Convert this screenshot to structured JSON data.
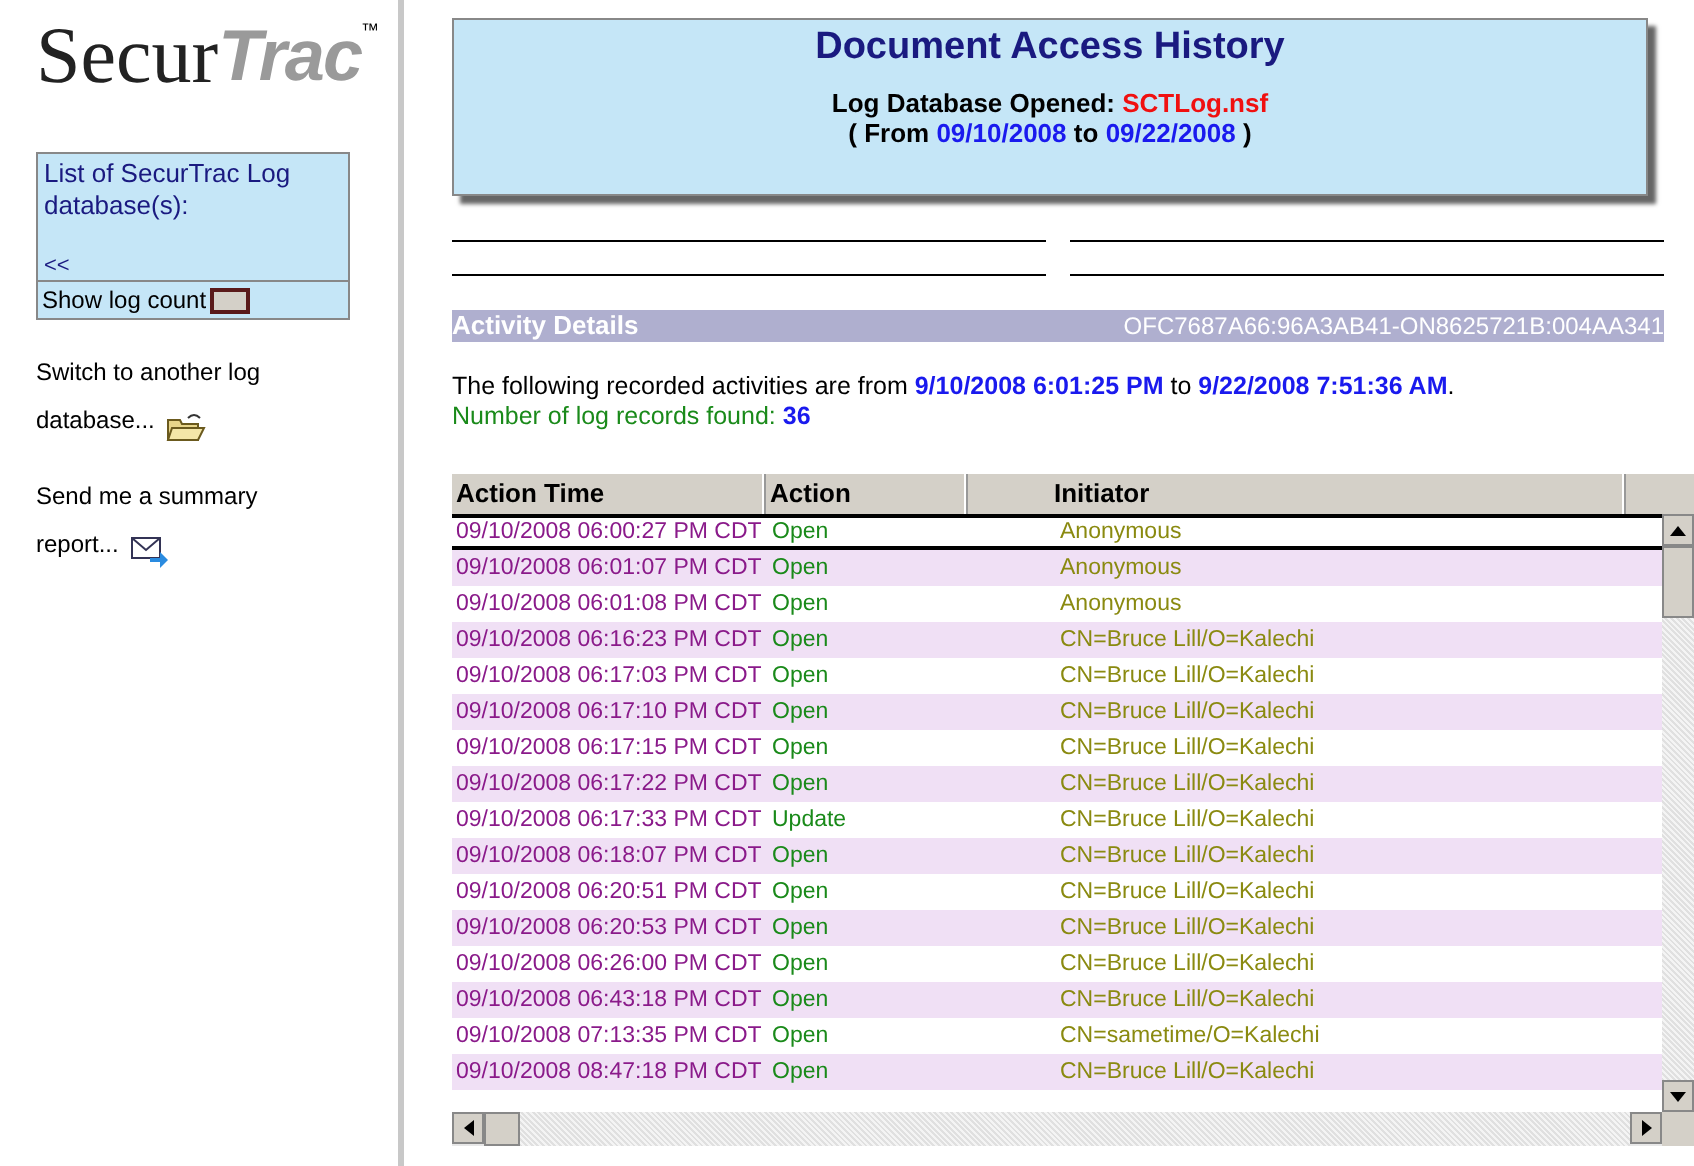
{
  "logo": {
    "part_1": "Secur",
    "part_2": "Trac",
    "mark": "™"
  },
  "sidebar": {
    "list_title": "List of SecurTrac Log database(s):",
    "back_link": "<<",
    "show_count_label": "Show log count",
    "links": [
      {
        "text": "Switch to another log database..."
      },
      {
        "text": "Send me a summary report..."
      }
    ]
  },
  "header": {
    "title": "Document Access History",
    "db_label": "Log Database Opened:",
    "db_name": "SCTLog.nsf",
    "range_open": "( From",
    "range_from": "09/10/2008",
    "range_to_word": "to",
    "range_to": "09/22/2008",
    "range_close": ")"
  },
  "details_bar": {
    "title": "Activity Details",
    "id": "OFC7687A66:96A3AB41-ON8625721B:004AA341"
  },
  "summary": {
    "text": "The following recorded activities are from **9/10/2008 6:01:25 PM** to **9/22/2008 7:51:36 AM**.",
    "count_label": "Number of log records found:",
    "count": "36"
  },
  "table": {
    "columns": [
      "Action Time",
      "Action",
      "Initiator"
    ],
    "rows": [
      {
        "time": "09/10/2008 06:00:27 PM CDT",
        "action": "Open",
        "initiator": "Anonymous",
        "selected": true
      },
      {
        "time": "09/10/2008 06:01:07 PM CDT",
        "action": "Open",
        "initiator": "Anonymous",
        "selected": false
      },
      {
        "time": "09/10/2008 06:01:08 PM CDT",
        "action": "Open",
        "initiator": "Anonymous",
        "selected": false
      },
      {
        "time": "09/10/2008 06:16:23 PM CDT",
        "action": "Open",
        "initiator": "CN=Bruce Lill/O=Kalechi",
        "selected": false
      },
      {
        "time": "09/10/2008 06:17:03 PM CDT",
        "action": "Open",
        "initiator": "CN=Bruce Lill/O=Kalechi",
        "selected": false
      },
      {
        "time": "09/10/2008 06:17:10 PM CDT",
        "action": "Open",
        "initiator": "CN=Bruce Lill/O=Kalechi",
        "selected": false
      },
      {
        "time": "09/10/2008 06:17:15 PM CDT",
        "action": "Open",
        "initiator": "CN=Bruce Lill/O=Kalechi",
        "selected": false
      },
      {
        "time": "09/10/2008 06:17:22 PM CDT",
        "action": "Open",
        "initiator": "CN=Bruce Lill/O=Kalechi",
        "selected": false
      },
      {
        "time": "09/10/2008 06:17:33 PM CDT",
        "action": "Update",
        "initiator": "CN=Bruce Lill/O=Kalechi",
        "selected": false
      },
      {
        "time": "09/10/2008 06:18:07 PM CDT",
        "action": "Open",
        "initiator": "CN=Bruce Lill/O=Kalechi",
        "selected": false
      },
      {
        "time": "09/10/2008 06:20:51 PM CDT",
        "action": "Open",
        "initiator": "CN=Bruce Lill/O=Kalechi",
        "selected": false
      },
      {
        "time": "09/10/2008 06:20:53 PM CDT",
        "action": "Open",
        "initiator": "CN=Bruce Lill/O=Kalechi",
        "selected": false
      },
      {
        "time": "09/10/2008 06:26:00 PM CDT",
        "action": "Open",
        "initiator": "CN=Bruce Lill/O=Kalechi",
        "selected": false
      },
      {
        "time": "09/10/2008 06:43:18 PM CDT",
        "action": "Open",
        "initiator": "CN=Bruce Lill/O=Kalechi",
        "selected": false
      },
      {
        "time": "09/10/2008 07:13:35 PM CDT",
        "action": "Open",
        "initiator": "CN=sametime/O=Kalechi",
        "selected": false
      },
      {
        "time": "09/10/2008 08:47:18 PM CDT",
        "action": "Open",
        "initiator": "CN=Bruce Lill/O=Kalechi",
        "selected": false
      }
    ]
  }
}
